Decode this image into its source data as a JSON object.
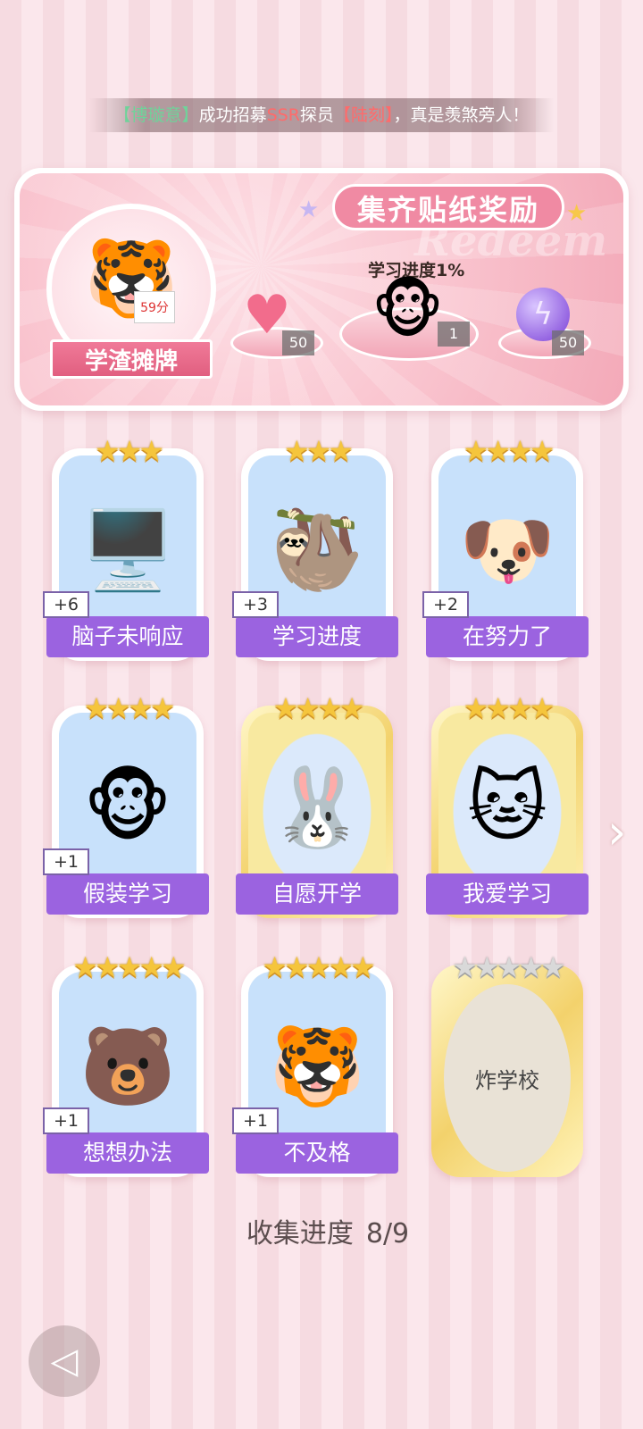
{
  "ticker": {
    "bracket_open_1": "【",
    "player": "博璇意",
    "bracket_close_1": "】",
    "middle": "成功招募",
    "rarity": "SSR",
    "role": "探员",
    "bracket_open_2": "【",
    "agent": "陆刻",
    "bracket_close_2": "】",
    "end": "，真是羡煞旁人！"
  },
  "banner": {
    "badge_title": "学渣摊牌",
    "badge_score": "59分",
    "reward_title": "集齐贴纸奖励",
    "watermark": "Redeem",
    "progress_tag": "学习进度1%",
    "rewards": [
      {
        "icon": "heart-gem-icon",
        "count": "50"
      },
      {
        "icon": "monkey-sticker-icon",
        "count": "1"
      },
      {
        "icon": "energy-orb-icon",
        "count": "50"
      }
    ]
  },
  "cards": [
    {
      "label": "脑子未响应",
      "plus": "+6",
      "stars": "★★★",
      "gold": false,
      "icon": "brain-not-responding-sticker",
      "emoji": "🖥️"
    },
    {
      "label": "学习进度",
      "plus": "+3",
      "stars": "★★★",
      "gold": false,
      "icon": "sloth-sticker",
      "emoji": "🦥"
    },
    {
      "label": "在努力了",
      "plus": "+2",
      "stars": "★★★★",
      "gold": false,
      "icon": "puppy-sticker",
      "emoji": "🐶"
    },
    {
      "label": "假装学习",
      "plus": "+1",
      "stars": "★★★★",
      "gold": false,
      "icon": "monkey-sticker",
      "emoji": "🐵"
    },
    {
      "label": "自愿开学",
      "plus": "",
      "stars": "★★★★",
      "gold": true,
      "icon": "rabbit-sticker",
      "emoji": "🐰"
    },
    {
      "label": "我爱学习",
      "plus": "",
      "stars": "★★★★",
      "gold": true,
      "icon": "angel-cat-sticker",
      "emoji": "🐱"
    },
    {
      "label": "想想办法",
      "plus": "+1",
      "stars": "★★★★★",
      "gold": false,
      "icon": "bear-brain-sticker",
      "emoji": "🐻"
    },
    {
      "label": "不及格",
      "plus": "+1",
      "stars": "★★★★★",
      "gold": false,
      "icon": "tiger-sticker",
      "emoji": "🐯"
    },
    {
      "label": "炸学校",
      "plus": "",
      "stars": "★★★★★",
      "gold": true,
      "locked": true,
      "icon": "locked-sticker",
      "emoji": ""
    }
  ],
  "collection": {
    "label": "收集进度",
    "value": "8/9"
  }
}
